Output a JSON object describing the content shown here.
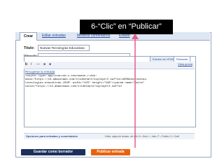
{
  "overlay": {
    "instruction": "6-“Clic” en “Publicar”"
  },
  "tabs": [
    "Crear",
    "Editar entradas",
    "Moderar comentarios",
    "Estado"
  ],
  "form": {
    "title_label": "Título:",
    "title_value": "Nuevas Tecnologías Educativas",
    "link_label": "Vínculo:"
  },
  "editor": {
    "mode_html": "Edición de HTML",
    "mode_compose": "Redactar",
    "preview": "Vista previa",
    "recover_link": "Recuperar la entrada",
    "toolbar_buttons": [
      "b",
      "i",
      "—",
      "■",
      "■"
    ],
    "code_lines": [
      "<object type=\"application/x-shockwave-flash\"",
      "data=\"https://s3.amazonaws.com/slideshare/ssplayer2.swf?id=1800&doc=nuevas-",
      "tecnologias-educativas-1500\" width=\"425\" height=\"348\"><param name=\"movie\"",
      "value=\"https://s3.amazonaws.com/slideshare/ssplayer2.swf?id"
    ]
  },
  "options": {
    "label": "Opciones para entradas y comentarios",
    "shortcuts": "Editor: atajos de teclado: ctrl with: B = Bold, I = Italic, P = Publish, D = Draft"
  },
  "buttons": {
    "save_draft": "Guardar como borrador",
    "publish": "Publicar entrada"
  },
  "colors": {
    "save_btn": "#1c2f5a",
    "publish_btn": "#e8620e",
    "arrow": "#e85a8a"
  }
}
